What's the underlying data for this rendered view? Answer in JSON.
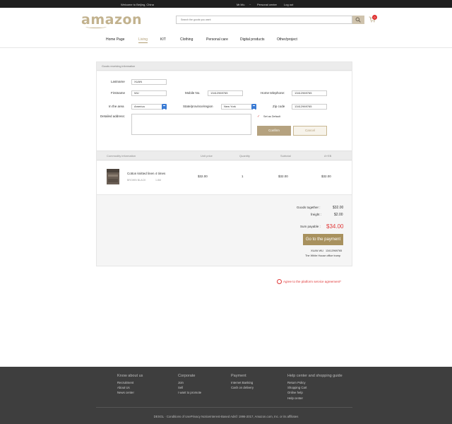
{
  "topbar": {
    "welcome": "Welcome to Beijing, China",
    "user": "Mr.Wu",
    "separator": "~",
    "personal_center": "Personal center",
    "logout": "Log out"
  },
  "header": {
    "logo": "amazon",
    "search_placeholder": "Search the goods you want",
    "cart_count": "0"
  },
  "nav": {
    "items": [
      "Home Page",
      "Living",
      "KIT",
      "Clothing",
      "Personal care",
      "Digital products",
      "Other/project"
    ],
    "active_index": 1
  },
  "address": {
    "section_title": "Goods receiving information",
    "lastname_label": "Lastname",
    "lastname_value": "XUAN",
    "firstname_label": "Firstname",
    "firstname_value": "WU",
    "mobile_label": "Mobile No.",
    "mobile_value": "13412969765",
    "home_tel_label": "Home telephone:",
    "home_tel_value": "13412969765",
    "area_label": "In the area",
    "area_value": "America",
    "state_label": "State/province/region",
    "state_value": "New York",
    "zip_label": "Zip code",
    "zip_value": "13412969765",
    "detail_label": "Detailed address:",
    "default_label": "Set as Default",
    "confirm_label": "Confirm",
    "cancel_label": "Cancel"
  },
  "table": {
    "headers": [
      "Commodity information",
      "Unit price",
      "Quantity",
      "Subtotal",
      "A+EB"
    ],
    "product": {
      "name": "Cotton knitted linen 4 times",
      "color": "BROWN BLACK",
      "size": "1.8M",
      "unit_price": "$32.00",
      "quantity": "1",
      "subtotal": "$32.00",
      "total": "$32.00"
    }
  },
  "summary": {
    "goods_label": "Goods together :",
    "goods_value": "$32.00",
    "freight_label": "freight :",
    "freight_value": "$2.00",
    "payable_label": "Sum payable :",
    "payable_value": "$34.00",
    "pay_button": "Go to the payment",
    "receiver_name": "XUAN WU",
    "receiver_phone": "13412969765",
    "receiver_address": "The White House office trump"
  },
  "agreement": {
    "text": "Agree to the platform service agreement*"
  },
  "footer": {
    "columns": [
      {
        "title": "Know about us",
        "items": [
          "Recruitment",
          "About Us",
          "News center"
        ]
      },
      {
        "title": "Corporate",
        "items": [
          "Join",
          "Sell",
          "I want to promote"
        ]
      },
      {
        "title": "Payment",
        "items": [
          "Internet Banking",
          "Cash on delivery"
        ]
      },
      {
        "title": "Help center and shopping guide",
        "items": [
          "Return Policy",
          "Shopping Cart",
          "Online help",
          "Help center"
        ]
      }
    ],
    "copyright": "DESGL · Conditions of UsePrivacy NoticeInterest-Based Ads© 1996-2017, Amazon.com, Inc. or its affiliates"
  },
  "colors": {
    "accent": "#b5a27f",
    "pay_button": "#a8915e",
    "price_red": "#e03a3a",
    "footer_bg": "#3e3e3e"
  }
}
